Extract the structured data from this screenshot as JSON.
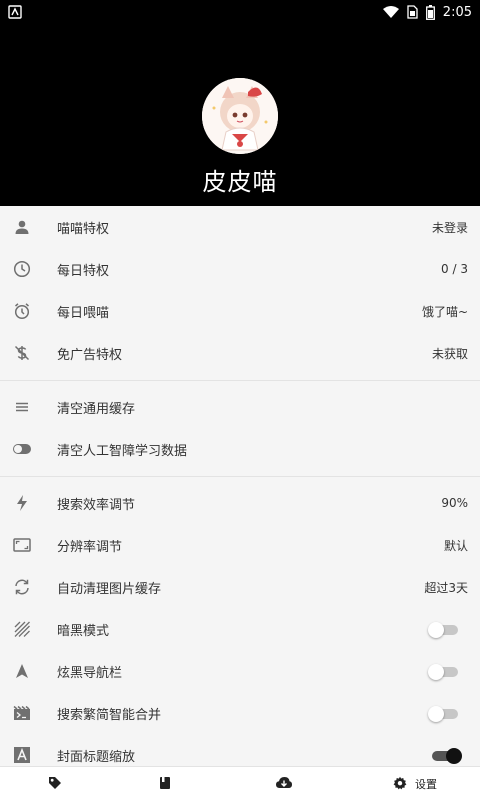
{
  "status_bar": {
    "time": "2:05",
    "icons": [
      "notification-icon",
      "wifi-icon",
      "sim-icon",
      "battery-icon"
    ]
  },
  "profile": {
    "username": "皮皮喵",
    "avatar": "avatar-image"
  },
  "sections": [
    {
      "rows": [
        {
          "icon": "person-icon",
          "label": "喵喵特权",
          "value": "未登录"
        },
        {
          "icon": "clock-icon",
          "label": "每日特权",
          "value": "0 / 3"
        },
        {
          "icon": "timer-icon",
          "label": "每日喂喵",
          "value": "饿了喵~"
        },
        {
          "icon": "no-money-icon",
          "label": "免广告特权",
          "value": "未获取"
        }
      ]
    },
    {
      "rows": [
        {
          "icon": "lines-icon",
          "label": "清空通用缓存"
        },
        {
          "icon": "toggle-icon",
          "label": "清空人工智障学习数据"
        }
      ]
    },
    {
      "rows": [
        {
          "icon": "flash-icon",
          "label": "搜索效率调节",
          "value": "90%"
        },
        {
          "icon": "aspect-ratio-icon",
          "label": "分辨率调节",
          "value": "默认"
        },
        {
          "icon": "sync-icon",
          "label": "自动清理图片缓存",
          "value": "超过3天"
        },
        {
          "icon": "stripes-icon",
          "label": "暗黑模式",
          "toggle": "off"
        },
        {
          "icon": "navigation-icon",
          "label": "炫黑导航栏",
          "toggle": "off"
        },
        {
          "icon": "movie-icon",
          "label": "搜索繁简智能合并",
          "toggle": "off"
        },
        {
          "icon": "font-icon",
          "label": "封面标题缩放",
          "toggle": "on"
        }
      ]
    }
  ],
  "bottom_nav": [
    {
      "icon": "tag-icon",
      "label": ""
    },
    {
      "icon": "book-icon",
      "label": ""
    },
    {
      "icon": "cloud-download-icon",
      "label": ""
    },
    {
      "icon": "gear-icon",
      "label": "设置"
    }
  ],
  "colors": {
    "header_bg": "#000000",
    "list_bg": "#f5f5f5",
    "icon_gray": "#707070",
    "toggle_off": "#c7c7c7",
    "toggle_on": "#111111"
  }
}
